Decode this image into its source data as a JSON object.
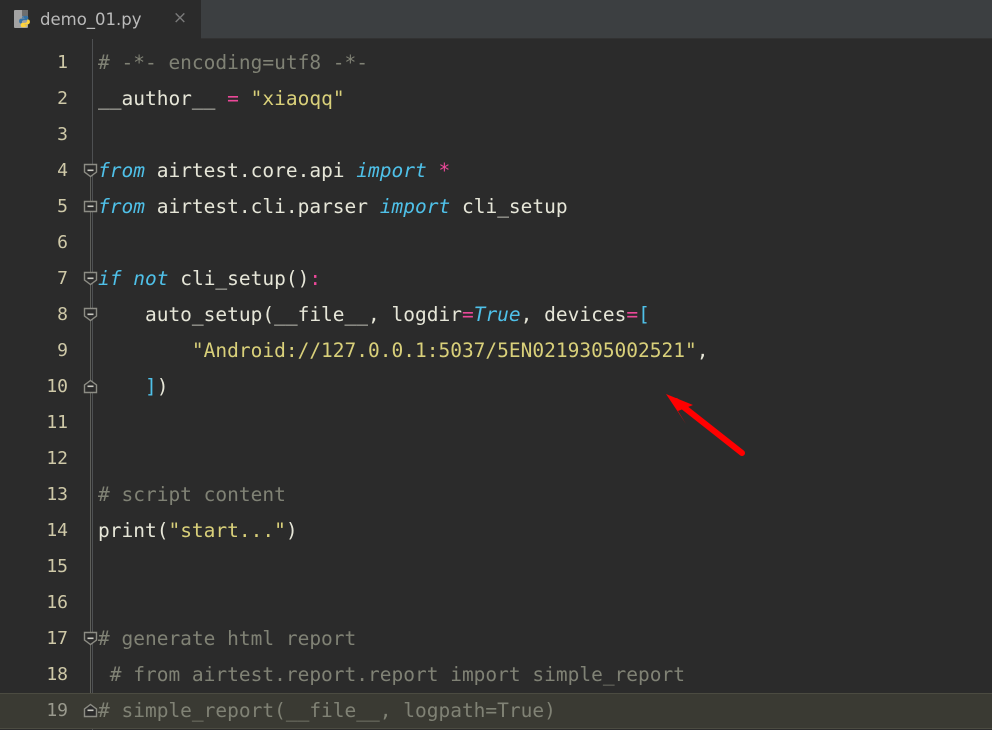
{
  "window": {
    "theme_background": "#2b2b2b",
    "tabbar_background": "#3c3f41"
  },
  "tabbar": {
    "active_tab": {
      "label": "demo_01.py",
      "icon": "python-file-icon",
      "close_label": "×"
    }
  },
  "editor": {
    "language": "python",
    "current_line": 19,
    "colors": {
      "comment": "#808275",
      "string": "#d9d07a",
      "keyword": "#4fc1e9",
      "operator": "#ec4899",
      "text": "#e6e6d8",
      "line_number": "#cfc9a8",
      "current_line_bg": "#3a3a33",
      "annotation_arrow": "#ff0000"
    },
    "lines": [
      {
        "number": "1",
        "fold": null,
        "spans": [
          {
            "cls": "c-com",
            "t": "# -*- encoding=utf8 -*-"
          }
        ]
      },
      {
        "number": "2",
        "fold": null,
        "spans": [
          {
            "cls": "c-txt",
            "t": "__author__ "
          },
          {
            "cls": "c-op",
            "t": "="
          },
          {
            "cls": "c-txt",
            "t": " "
          },
          {
            "cls": "c-str",
            "t": "\"xiaoqq\""
          }
        ]
      },
      {
        "number": "3",
        "fold": null,
        "spans": []
      },
      {
        "number": "4",
        "fold": "collapse-down",
        "spans": [
          {
            "cls": "c-kw",
            "t": "from"
          },
          {
            "cls": "c-txt",
            "t": " airtest.core.api "
          },
          {
            "cls": "c-kw",
            "t": "import"
          },
          {
            "cls": "c-txt",
            "t": " "
          },
          {
            "cls": "c-op",
            "t": "*"
          }
        ]
      },
      {
        "number": "5",
        "fold": "collapse-up",
        "spans": [
          {
            "cls": "c-kw",
            "t": "from"
          },
          {
            "cls": "c-txt",
            "t": " airtest.cli.parser "
          },
          {
            "cls": "c-kw",
            "t": "import"
          },
          {
            "cls": "c-txt",
            "t": " cli_setup"
          }
        ]
      },
      {
        "number": "6",
        "fold": null,
        "spans": []
      },
      {
        "number": "7",
        "fold": "collapse-down",
        "spans": [
          {
            "cls": "c-kw",
            "t": "if"
          },
          {
            "cls": "c-txt",
            "t": " "
          },
          {
            "cls": "c-kw",
            "t": "not"
          },
          {
            "cls": "c-txt",
            "t": " cli_setup()"
          },
          {
            "cls": "c-op",
            "t": ":"
          }
        ]
      },
      {
        "number": "8",
        "fold": "collapse-down",
        "spans": [
          {
            "cls": "c-txt",
            "t": "    auto_setup(__file__, logdir"
          },
          {
            "cls": "c-op",
            "t": "="
          },
          {
            "cls": "c-kw",
            "t": "True"
          },
          {
            "cls": "c-txt",
            "t": ", devices"
          },
          {
            "cls": "c-op",
            "t": "="
          },
          {
            "cls": "c-brk",
            "t": "["
          }
        ]
      },
      {
        "number": "9",
        "fold": null,
        "spans": [
          {
            "cls": "c-txt",
            "t": "        "
          },
          {
            "cls": "c-str",
            "t": "\"Android://127.0.0.1:5037/5EN0219305002521\""
          },
          {
            "cls": "c-txt",
            "t": ","
          }
        ]
      },
      {
        "number": "10",
        "fold": "collapse-end",
        "spans": [
          {
            "cls": "c-txt",
            "t": "    "
          },
          {
            "cls": "c-brk",
            "t": "]"
          },
          {
            "cls": "c-txt",
            "t": ")"
          }
        ]
      },
      {
        "number": "11",
        "fold": null,
        "spans": []
      },
      {
        "number": "12",
        "fold": null,
        "spans": []
      },
      {
        "number": "13",
        "fold": null,
        "spans": [
          {
            "cls": "c-com",
            "t": "# script content"
          }
        ]
      },
      {
        "number": "14",
        "fold": null,
        "spans": [
          {
            "cls": "c-txt",
            "t": "print("
          },
          {
            "cls": "c-str",
            "t": "\"start...\""
          },
          {
            "cls": "c-txt",
            "t": ")"
          }
        ]
      },
      {
        "number": "15",
        "fold": null,
        "spans": []
      },
      {
        "number": "16",
        "fold": null,
        "spans": []
      },
      {
        "number": "17",
        "fold": "collapse-down",
        "spans": [
          {
            "cls": "c-com",
            "t": "# generate html report"
          }
        ]
      },
      {
        "number": "18",
        "fold": null,
        "spans": [
          {
            "cls": "c-com",
            "t": " # from airtest.report.report import simple_report"
          }
        ]
      },
      {
        "number": "19",
        "fold": "collapse-end",
        "spans": [
          {
            "cls": "c-com",
            "t": "# simple_report(__file__, logpath=True)"
          }
        ]
      }
    ]
  },
  "annotation": {
    "type": "arrow",
    "points_to": "device-serial-string",
    "color": "#ff0000"
  }
}
